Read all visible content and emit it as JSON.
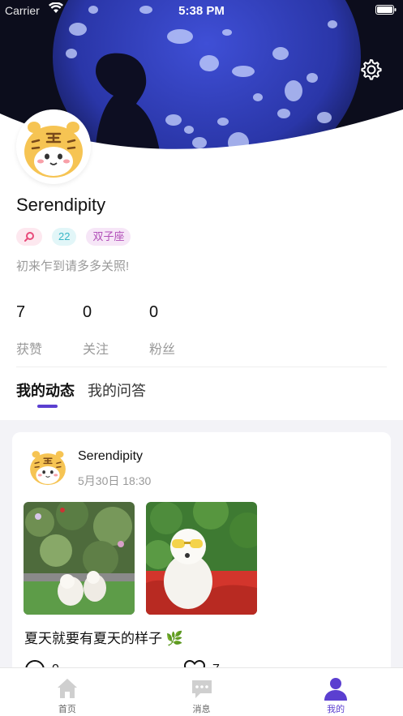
{
  "status_bar": {
    "carrier": "Carrier",
    "time": "5:38 PM"
  },
  "profile": {
    "username": "Serendipity",
    "tags": {
      "age": "22",
      "zodiac": "双子座"
    },
    "bio": "初来乍到请多多关照!",
    "stats": [
      {
        "value": "7",
        "label": "获赞"
      },
      {
        "value": "0",
        "label": "关注"
      },
      {
        "value": "0",
        "label": "粉丝"
      }
    ]
  },
  "tabs": [
    {
      "label": "我的动态",
      "active": true
    },
    {
      "label": "我的问答",
      "active": false
    }
  ],
  "post": {
    "author": "Serendipity",
    "time": "5月30日 18:30",
    "text": "夏天就要有夏天的样子 🌿",
    "comment_count": "0",
    "like_count": "7"
  },
  "tabbar": {
    "items": [
      {
        "label": "首页",
        "icon": "home-icon"
      },
      {
        "label": "消息",
        "icon": "message-icon"
      },
      {
        "label": "我的",
        "icon": "profile-icon"
      }
    ]
  },
  "colors": {
    "accent": "#5b3fd0",
    "muted_text": "#999999",
    "feed_background": "#f3f3f7"
  }
}
